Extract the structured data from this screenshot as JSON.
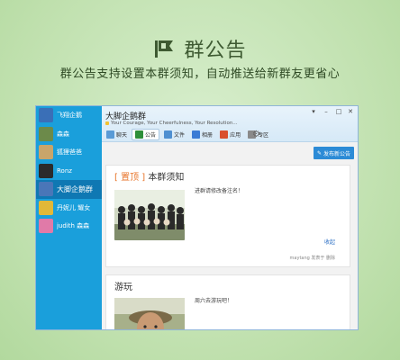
{
  "hero": {
    "title": "群公告",
    "subtitle": "群公告支持设置本群须知，自动推送给新群友更省心",
    "icon": "megaphone-flag-icon"
  },
  "sidebar": {
    "items": [
      {
        "label": "飞翔企鹅",
        "active": false,
        "avatar_color": "#3a6fb7"
      },
      {
        "label": "森森",
        "active": false,
        "avatar_color": "#6c8a4a"
      },
      {
        "label": "狐狸爸爸",
        "active": false,
        "avatar_color": "#c9a56a"
      },
      {
        "label": "Ronz",
        "active": false,
        "avatar_color": "#2b2b2b"
      },
      {
        "label": "大脚企鹅群",
        "active": true,
        "avatar_color": "#4a76b8"
      },
      {
        "label": "丹妮儿 耀女",
        "active": false,
        "avatar_color": "#e2b838"
      },
      {
        "label": "judith 森森",
        "active": false,
        "avatar_color": "#e07aa8"
      }
    ]
  },
  "window": {
    "group_name": "大脚企鹅群",
    "motto": "Your Courage, Your Cheerfulness, Your Resolution...",
    "controls": [
      "▾",
      "–",
      "□",
      "✕"
    ],
    "tabs": [
      {
        "label": "聊天",
        "icon": "chat-icon",
        "color": "#5a9bd6",
        "active": false
      },
      {
        "label": "公告",
        "icon": "flag-icon",
        "color": "#2f8f3a",
        "active": true
      },
      {
        "label": "文件",
        "icon": "file-icon",
        "color": "#4d8fd1",
        "active": false
      },
      {
        "label": "相册",
        "icon": "album-icon",
        "color": "#3a7bd5",
        "active": false
      },
      {
        "label": "应用",
        "icon": "app-icon",
        "color": "#d9502f",
        "active": false
      },
      {
        "label": "专区",
        "icon": "zone-icon",
        "color": "#8a8a8a",
        "active": false
      }
    ],
    "publish_label": "发布新公告",
    "notices": [
      {
        "pin_label": "[ 置顶 ]",
        "title": "本群须知",
        "text": "进群请修改备注名！",
        "collapse_label": "收起",
        "meta": "maytang 发表于 删除"
      },
      {
        "title": "游玩",
        "text": "周六去游玩吧！"
      }
    ]
  }
}
